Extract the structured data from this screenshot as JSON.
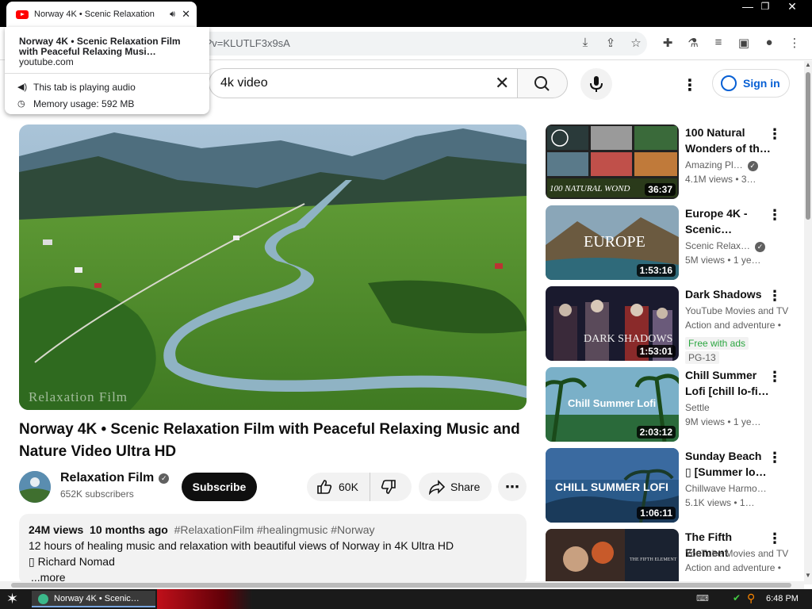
{
  "browser": {
    "tab_title": "Norway 4K • Scenic Relaxation",
    "url_fragment": "?v=KLUTLF3x9sA",
    "tooltip": {
      "title": "Norway 4K • Scenic Relaxation Film with Peaceful Relaxing Musi…",
      "domain": "youtube.com",
      "audio": "This tab is playing audio",
      "memory": "Memory usage: 592 MB"
    }
  },
  "youtube": {
    "search_value": "4k video",
    "signin_label": "Sign in"
  },
  "video": {
    "watermark": "Relaxation Film",
    "title": "Norway 4K • Scenic Relaxation Film with Peaceful Relaxing Music and Nature Video Ultra HD",
    "channel": "Relaxation Film",
    "subscribers": "652K subscribers",
    "subscribe_label": "Subscribe",
    "likes": "60K",
    "share_label": "Share",
    "views": "24M views",
    "age": "10 months ago",
    "hashtags": "#RelaxationFilm #healingmusic #Norway",
    "description_line1": "12 hours of healing music and relaxation with beautiful views of Norway in 4K Ultra HD",
    "description_line2": "▯ Richard Nomad",
    "more_label": "...more"
  },
  "recommendations": [
    {
      "title": "100 Natural Wonders of th…",
      "channel": "Amazing Pl…",
      "stats": "4.1M views  • 3…",
      "duration": "36:37",
      "thumb_text": "100 NATURAL WOND"
    },
    {
      "title": "Europe 4K - Scenic…",
      "channel": "Scenic Relax…",
      "stats": "5M views  • 1 ye…",
      "duration": "1:53:16",
      "thumb_text": "EUROPE"
    },
    {
      "title": "Dark Shadows",
      "channel": "YouTube Movies and TV",
      "stats": "Action and adventure •",
      "duration": "1:53:01",
      "thumb_text": "DARK SHADOWS",
      "badge_free": "Free with ads",
      "badge_rating": "PG-13"
    },
    {
      "title": "Chill Summer Lofi [chill lo-fi…",
      "channel": "Settle",
      "stats": "9M views  • 1 ye…",
      "duration": "2:03:12",
      "thumb_text": "Chill Summer Lofi"
    },
    {
      "title": "Sunday Beach ▯ [Summer lo…",
      "channel": "Chillwave Harmo…",
      "stats": "5.1K views  • 1…",
      "duration": "1:06:11",
      "thumb_text": "CHILL SUMMER LOFI"
    },
    {
      "title": "The Fifth Element",
      "channel": "YouTube Movies and TV",
      "stats": "Action and adventure •",
      "duration": "",
      "thumb_text": "THE FIFTH ELEMENT"
    }
  ],
  "taskbar": {
    "app_label": "Norway 4K • Scenic…",
    "clock": "6:48 PM"
  },
  "colors": {
    "brand_red": "#ff0000",
    "link_blue": "#065fd4",
    "free_green": "#2ba640"
  }
}
